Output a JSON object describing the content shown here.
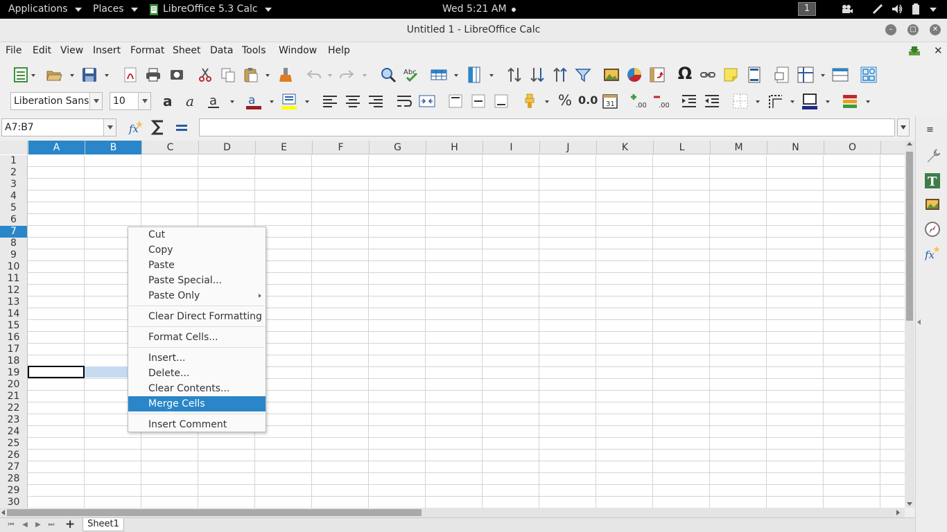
{
  "topbar": {
    "applications": "Applications",
    "places": "Places",
    "app_name": "LibreOffice 5.3 Calc",
    "clock": "Wed  5:21 AM",
    "workspace": "1"
  },
  "window": {
    "title": "Untitled 1 - LibreOffice Calc"
  },
  "menubar": [
    "File",
    "Edit",
    "View",
    "Insert",
    "Format",
    "Sheet",
    "Data",
    "Tools",
    "Window",
    "Help"
  ],
  "formatting": {
    "font_name": "Liberation Sans",
    "font_size": "10"
  },
  "formula_bar": {
    "name_box": "A7:B7",
    "content": ""
  },
  "columns": [
    "A",
    "B",
    "C",
    "D",
    "E",
    "F",
    "G",
    "H",
    "I",
    "J",
    "K",
    "L",
    "M",
    "N",
    "O"
  ],
  "rows": [
    "1",
    "2",
    "3",
    "4",
    "5",
    "6",
    "7",
    "8",
    "9",
    "10",
    "11",
    "12",
    "13",
    "14",
    "15",
    "16",
    "17",
    "18",
    "19",
    "20",
    "21",
    "22",
    "23",
    "24",
    "25",
    "26",
    "27",
    "28",
    "29",
    "30"
  ],
  "selected_columns": [
    "A",
    "B"
  ],
  "selected_row": "7",
  "sheet_tabs": [
    "Sheet1"
  ],
  "context_menu": {
    "cut": "Cut",
    "copy": "Copy",
    "paste": "Paste",
    "paste_special": "Paste Special...",
    "paste_only": "Paste Only",
    "clear_direct_formatting": "Clear Direct Formatting",
    "format_cells": "Format Cells...",
    "insert": "Insert...",
    "delete": "Delete...",
    "clear_contents": "Clear Contents...",
    "merge_cells": "Merge Cells",
    "insert_comment": "Insert Comment"
  },
  "colors": {
    "selection": "#2a86c8",
    "topbar": "#000000"
  }
}
